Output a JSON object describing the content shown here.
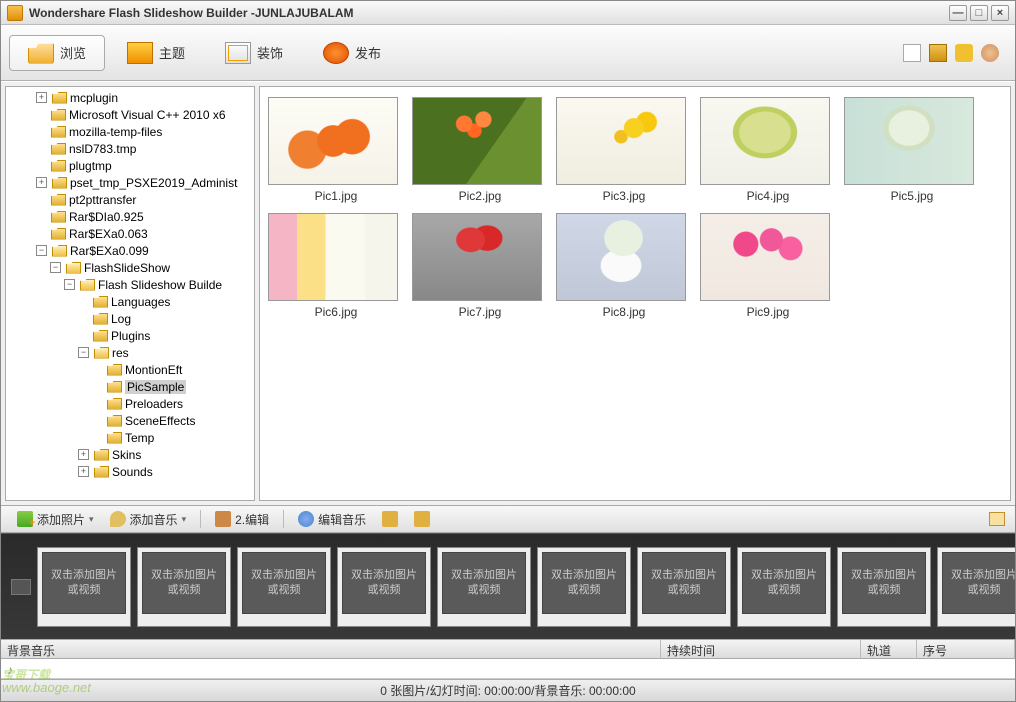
{
  "title": "Wondershare Flash Slideshow Builder -JUNLAJUBALAM",
  "tabs": {
    "browse": "浏览",
    "theme": "主题",
    "decor": "装饰",
    "publish": "发布"
  },
  "tree": [
    {
      "indent": 28,
      "toggle": "+",
      "label": "mcplugin"
    },
    {
      "indent": 40,
      "label": "Microsoft Visual C++ 2010  x6"
    },
    {
      "indent": 40,
      "label": "mozilla-temp-files"
    },
    {
      "indent": 40,
      "label": "nslD783.tmp"
    },
    {
      "indent": 40,
      "label": "plugtmp"
    },
    {
      "indent": 28,
      "toggle": "+",
      "label": "pset_tmp_PSXE2019_Administ"
    },
    {
      "indent": 40,
      "label": "pt2pttransfer"
    },
    {
      "indent": 40,
      "label": "Rar$DIa0.925"
    },
    {
      "indent": 40,
      "label": "Rar$EXa0.063"
    },
    {
      "indent": 28,
      "toggle": "−",
      "label": "Rar$EXa0.099",
      "open": true
    },
    {
      "indent": 42,
      "toggle": "−",
      "label": "FlashSlideShow",
      "open": true
    },
    {
      "indent": 56,
      "toggle": "−",
      "label": "Flash Slideshow Builde",
      "open": true
    },
    {
      "indent": 82,
      "label": "Languages"
    },
    {
      "indent": 82,
      "label": "Log"
    },
    {
      "indent": 82,
      "label": "Plugins"
    },
    {
      "indent": 70,
      "toggle": "−",
      "label": "res",
      "open": true
    },
    {
      "indent": 96,
      "label": "MontionEft"
    },
    {
      "indent": 96,
      "label": "PicSample",
      "selected": true
    },
    {
      "indent": 96,
      "label": "Preloaders"
    },
    {
      "indent": 96,
      "label": "SceneEffects"
    },
    {
      "indent": 96,
      "label": "Temp"
    },
    {
      "indent": 70,
      "toggle": "+",
      "label": "Skins"
    },
    {
      "indent": 70,
      "toggle": "+",
      "label": "Sounds"
    }
  ],
  "thumbs": [
    {
      "name": "Pic1.jpg",
      "cls": "f1"
    },
    {
      "name": "Pic2.jpg",
      "cls": "f2"
    },
    {
      "name": "Pic3.jpg",
      "cls": "f3"
    },
    {
      "name": "Pic4.jpg",
      "cls": "f4"
    },
    {
      "name": "Pic5.jpg",
      "cls": "f5"
    },
    {
      "name": "Pic6.jpg",
      "cls": "f6"
    },
    {
      "name": "Pic7.jpg",
      "cls": "f7"
    },
    {
      "name": "Pic8.jpg",
      "cls": "f8"
    },
    {
      "name": "Pic9.jpg",
      "cls": "f9"
    }
  ],
  "mid": {
    "addphoto": "添加照片",
    "addmusic": "添加音乐",
    "edit": "2.编辑",
    "editmusic": "编辑音乐"
  },
  "slot_text": "双击添加图片或视频",
  "columns": {
    "bgmusic": "背景音乐",
    "duration": "持续时间",
    "track": "轨道",
    "order": "序号"
  },
  "status": "0 张图片/幻灯时间: 00:00:00/背景音乐: 00:00:00",
  "watermark": {
    "main": "宝哥下载",
    "sub": "www.baoge.net"
  }
}
